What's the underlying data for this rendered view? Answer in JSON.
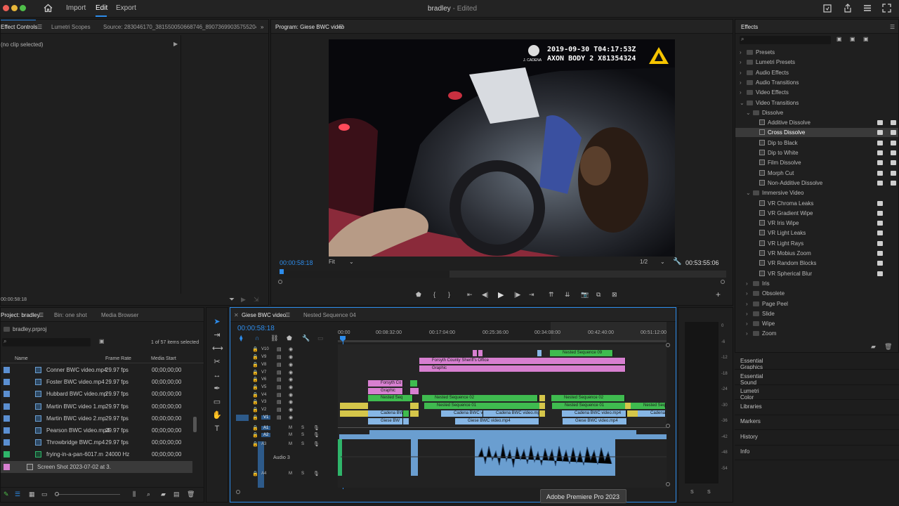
{
  "window": {
    "title": "bradley",
    "status": "- Edited"
  },
  "nav": {
    "import": "Import",
    "edit": "Edit",
    "export": "Export"
  },
  "source_panel": {
    "tab_effect_controls": "Effect Controls",
    "tab_lumetri": "Lumetri Scopes",
    "tab_source": "Source: 283046170_381550050668746_8907369903575520413_n.png",
    "no_clip": "(no clip selected)",
    "timecode": "00:00:58:18"
  },
  "program": {
    "title": "Program: Giese BWC video",
    "timecode_in": "00:00:58:18",
    "fit": "Fit",
    "resolution": "1/2",
    "duration": "00:53:55:06",
    "video_overlay_line1": "2019-09-30 T04:17:53Z",
    "video_overlay_line2": "AXON BODY 2 X81354324",
    "video_badge": "J. CADENA"
  },
  "effects": {
    "title": "Effects",
    "items": [
      {
        "label": "Presets",
        "level": 0,
        "type": "folder",
        "open": false
      },
      {
        "label": "Lumetri Presets",
        "level": 0,
        "type": "folder",
        "open": false
      },
      {
        "label": "Audio Effects",
        "level": 0,
        "type": "folder",
        "open": false
      },
      {
        "label": "Audio Transitions",
        "level": 0,
        "type": "folder",
        "open": false
      },
      {
        "label": "Video Effects",
        "level": 0,
        "type": "folder",
        "open": false
      },
      {
        "label": "Video Transitions",
        "level": 0,
        "type": "folder",
        "open": true
      },
      {
        "label": "Dissolve",
        "level": 1,
        "type": "folder",
        "open": true
      },
      {
        "label": "Additive Dissolve",
        "level": 2,
        "type": "fx"
      },
      {
        "label": "Cross Dissolve",
        "level": 2,
        "type": "fx",
        "selected": true
      },
      {
        "label": "Dip to Black",
        "level": 2,
        "type": "fx"
      },
      {
        "label": "Dip to White",
        "level": 2,
        "type": "fx"
      },
      {
        "label": "Film Dissolve",
        "level": 2,
        "type": "fx"
      },
      {
        "label": "Morph Cut",
        "level": 2,
        "type": "fx"
      },
      {
        "label": "Non-Additive Dissolve",
        "level": 2,
        "type": "fx"
      },
      {
        "label": "Immersive Video",
        "level": 1,
        "type": "folder",
        "open": true
      },
      {
        "label": "VR Chroma Leaks",
        "level": 2,
        "type": "fx"
      },
      {
        "label": "VR Gradient Wipe",
        "level": 2,
        "type": "fx"
      },
      {
        "label": "VR Iris Wipe",
        "level": 2,
        "type": "fx"
      },
      {
        "label": "VR Light Leaks",
        "level": 2,
        "type": "fx"
      },
      {
        "label": "VR Light Rays",
        "level": 2,
        "type": "fx"
      },
      {
        "label": "VR Mobius Zoom",
        "level": 2,
        "type": "fx"
      },
      {
        "label": "VR Random Blocks",
        "level": 2,
        "type": "fx"
      },
      {
        "label": "VR Spherical Blur",
        "level": 2,
        "type": "fx"
      },
      {
        "label": "Iris",
        "level": 1,
        "type": "folder",
        "open": false
      },
      {
        "label": "Obsolete",
        "level": 1,
        "type": "folder",
        "open": false
      },
      {
        "label": "Page Peel",
        "level": 1,
        "type": "folder",
        "open": false
      },
      {
        "label": "Slide",
        "level": 1,
        "type": "folder",
        "open": false
      },
      {
        "label": "Wipe",
        "level": 1,
        "type": "folder",
        "open": false
      },
      {
        "label": "Zoom",
        "level": 1,
        "type": "folder",
        "open": false
      }
    ]
  },
  "side_panels": [
    "Essential Graphics",
    "Essential Sound",
    "Lumetri Color",
    "Libraries",
    "Markers",
    "History",
    "Info"
  ],
  "project": {
    "tab_project": "Project: bradley",
    "tab_bin": "Bin: one shot",
    "tab_media": "Media Browser",
    "file": "bradley.prproj",
    "count": "1 of 57 items selected",
    "col_name": "Name",
    "col_frame": "Frame Rate",
    "col_start": "Media Start",
    "rows": [
      {
        "name": "Conner BWC video.mp4",
        "fps": "29.97 fps",
        "start": "00;00;00;00",
        "color": "#5b8fd1"
      },
      {
        "name": "Foster BWC video.mp4",
        "fps": "29.97 fps",
        "start": "00;00;00;00",
        "color": "#5b8fd1"
      },
      {
        "name": "Hubbard BWC video.mp",
        "fps": "29.97 fps",
        "start": "00;00;00;00",
        "color": "#5b8fd1"
      },
      {
        "name": "Martin BWC video 1.mp",
        "fps": "29.97 fps",
        "start": "00;00;00;00",
        "color": "#5b8fd1"
      },
      {
        "name": "Martin BWC video 2.mp",
        "fps": "29.97 fps",
        "start": "00;00;00;00",
        "color": "#5b8fd1"
      },
      {
        "name": "Pearson BWC video.mp4",
        "fps": "29.97 fps",
        "start": "00;00;00;00",
        "color": "#5b8fd1"
      },
      {
        "name": "Throwbridge BWC.mp4",
        "fps": "29.97 fps",
        "start": "00;00;00;00",
        "color": "#5b8fd1"
      },
      {
        "name": "frying-in-a-pan-6017.m",
        "fps": "24000 Hz",
        "start": "00;00;00;00",
        "color": "#2fb56a"
      },
      {
        "name": "Screen Shot 2023-07-02 at 3.",
        "fps": "",
        "start": "",
        "color": "#d77fd0"
      }
    ]
  },
  "timeline": {
    "tab_active": "Giese BWC video",
    "tab_other": "Nested Sequence 04",
    "timecode": "00:00:58:18",
    "ruler": [
      "00:00",
      "00:08:32:00",
      "00:17:04:00",
      "00:25:36:00",
      "00:34:08:00",
      "00:42:40:00",
      "00:51:12:00"
    ],
    "video_tracks": [
      "V10",
      "V9",
      "V8",
      "V7",
      "V6",
      "V5",
      "V4",
      "V3",
      "V2",
      "V1"
    ],
    "audio_tracks": [
      "A1",
      "A2",
      "A3",
      "A4"
    ],
    "audio3_label": "Audio 3",
    "clips": {
      "nested09": "Nested Sequence 09",
      "forsyth": "Forsyth County Sheriff's Office",
      "graphic": "Graphic",
      "forsyth_short": "Forsyth Co",
      "graphic_short": "Graphic",
      "nested_seq": "Nested Seq",
      "nested02": "Nested Sequence 02",
      "nested01": "Nested Sequence 01",
      "nested_seq_r": "Nested Seq",
      "cadena_bw": "Cadena BW",
      "cadena1": "Cadena BWC vi",
      "cadena2": "Cadena BWC video.mp4",
      "cadena3": "Cadena BWC video.mp4",
      "cadena4": "Cadena BWC",
      "giese_bw": "Giese BW",
      "giese1": "Giese BWC video.mp4",
      "giese2": "Giese BWC video.mp4"
    },
    "meter_labels": [
      "0",
      "-6",
      "-12",
      "-18",
      "-24",
      "-30",
      "-36",
      "-42",
      "-48",
      "-54"
    ],
    "meter_solo": "S"
  },
  "tooltip": "Adobe Premiere Pro 2023"
}
